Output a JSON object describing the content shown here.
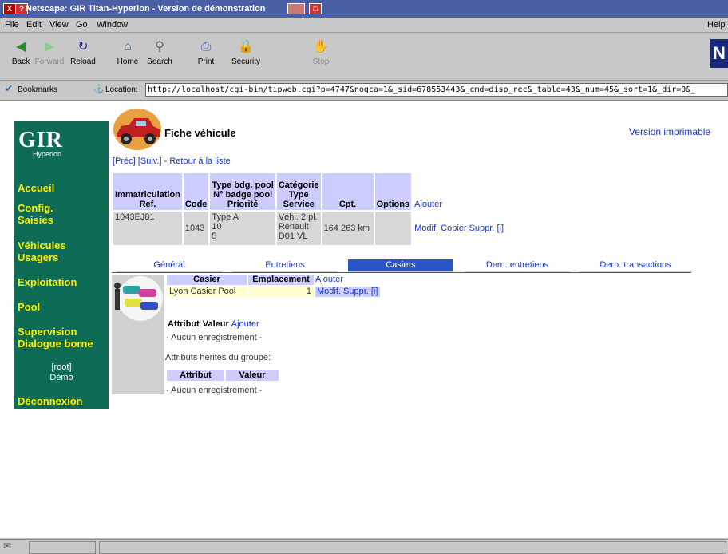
{
  "window": {
    "title": "Netscape: GIR Titan-Hyperion - Version de démonstration"
  },
  "menu": {
    "items": [
      "File",
      "Edit",
      "View",
      "Go",
      "Window"
    ],
    "help": "Help"
  },
  "toolbar": {
    "buttons": [
      {
        "label": "Back",
        "icon": "back-icon"
      },
      {
        "label": "Forward",
        "icon": "forward-icon"
      },
      {
        "label": "Reload",
        "icon": "reload-icon"
      },
      {
        "label": "Home",
        "icon": "home-icon"
      },
      {
        "label": "Search",
        "icon": "search-icon"
      },
      {
        "label": "Print",
        "icon": "print-icon"
      },
      {
        "label": "Security",
        "icon": "security-icon"
      },
      {
        "label": "Stop",
        "icon": "stop-icon"
      }
    ]
  },
  "location": {
    "bookmarks_label": "Bookmarks",
    "location_label": "Location:",
    "url": "http://localhost/cgi-bin/tipweb.cgi?p=4747&nogca=1&_sid=678553443&_cmd=disp_rec&_table=43&_num=45&_sort=1&_dir=0&_"
  },
  "sidebar": {
    "logo": {
      "gir": "GIR",
      "hyperion": "Hyperion"
    },
    "items": [
      "Accueil",
      "Config.",
      "Saisies",
      "Véhicules",
      "Usagers",
      "Exploitation",
      "Pool",
      "Supervision",
      "Dialogue borne"
    ],
    "user": {
      "login": "[root]",
      "name": "Démo"
    },
    "logout": "Déconnexion"
  },
  "page": {
    "title": "Fiche véhicule",
    "print_link": "Version imprimable",
    "nav": {
      "prev": "[Préc]",
      "next": "[Suiv.]",
      "sep": " - ",
      "back": "Retour à la liste"
    }
  },
  "vehicle_table": {
    "headers": {
      "immat": "Immatriculation",
      "ref": "Ref.",
      "code": "Code",
      "type_bdg": "Type bdg. pool",
      "badge": "N° badge pool",
      "priorite": "Priorité",
      "categorie": "Catégorie",
      "type": "Type",
      "service": "Service",
      "cpt": "Cpt.",
      "options": "Options",
      "add": "Ajouter"
    },
    "row": {
      "immat": "1043EJ81",
      "code": "1043",
      "type_bdg": "Type A",
      "badge": "10",
      "priorite": "5",
      "categorie": "Véhi. 2 pl.",
      "type": "Renault",
      "service": "D01 VL",
      "cpt": "164 263 km",
      "actions": "Modif. Copier Suppr. [i]"
    }
  },
  "tabs": [
    "Général",
    "Entretiens",
    "Casiers",
    "Dern. entretiens",
    "Dern. transactions"
  ],
  "active_tab": "Casiers",
  "casiers": {
    "headers": {
      "casier": "Casier",
      "emplacement": "Emplacement",
      "add": "Ajouter"
    },
    "rows": [
      {
        "casier": "Lyon Casier Pool",
        "emplacement": "1",
        "actions": "Modif. Suppr. [i]"
      }
    ]
  },
  "attributes": {
    "headers": {
      "attribut": "Attribut",
      "valeur": "Valeur",
      "add": "Ajouter"
    },
    "empty": "- Aucun enregistrement -",
    "inherited_label": "Attributs hérités du groupe:",
    "inherited_headers": {
      "attribut": "Attribut",
      "valeur": "Valeur"
    },
    "inherited_empty": "- Aucun enregistrement -"
  },
  "colors": {
    "sidebar_bg": "#0d6b56",
    "nav_yellow": "#ffea00",
    "link_blue": "#1a35c8",
    "header_lavender": "#ccccff",
    "active_tab": "#2a55c8"
  }
}
